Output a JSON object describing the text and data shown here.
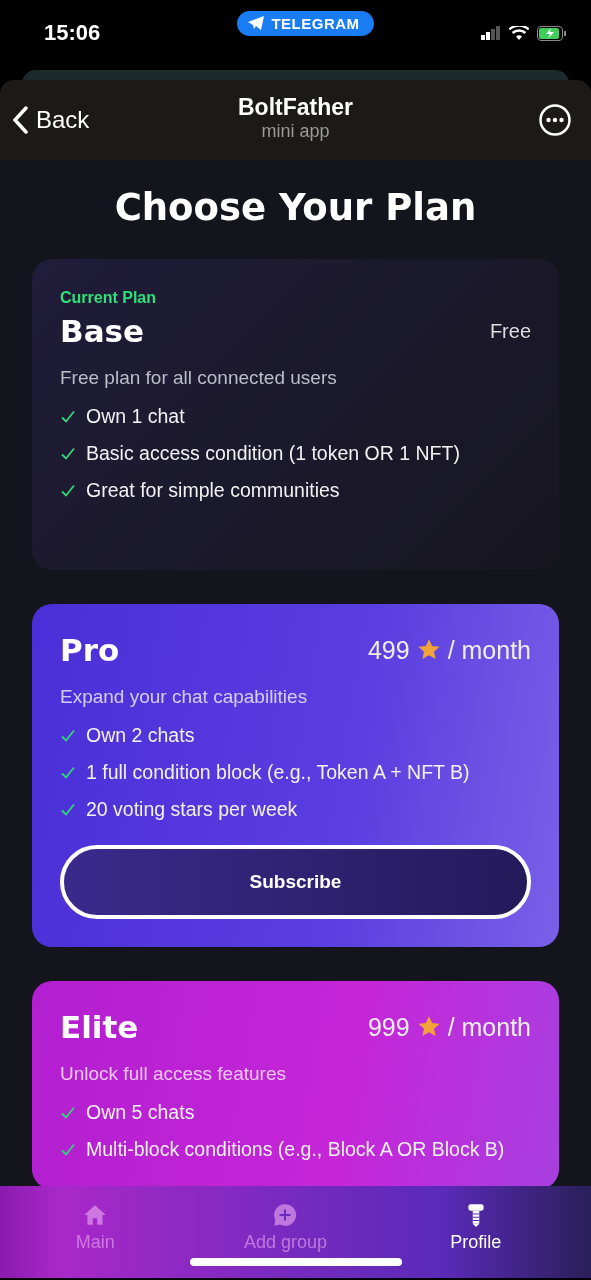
{
  "status_bar": {
    "time": "15:06",
    "app_pill": "TELEGRAM"
  },
  "header": {
    "back": "Back",
    "title": "BoltFather",
    "subtitle": "mini app"
  },
  "page_title": "Choose Your Plan",
  "plans": [
    {
      "kind": "current",
      "badge": "Current Plan",
      "name": "Base",
      "price": "Free",
      "description": "Free plan for all connected users",
      "features": [
        "Own 1 chat",
        "Basic access condition (1 token OR 1 NFT)",
        "Great for simple communities"
      ]
    },
    {
      "kind": "pro",
      "name": "Pro",
      "price": "499",
      "unit": "/ month",
      "description": "Expand your chat capabilities",
      "features": [
        "Own 2 chats",
        "1 full condition block (e.g., Token A + NFT B)",
        "20 voting stars per week"
      ],
      "button": "Subscribe"
    },
    {
      "kind": "elite",
      "name": "Elite",
      "price": "999",
      "unit": "/ month",
      "description": "Unlock full access features",
      "features": [
        "Own 5 chats",
        "Multi-block conditions (e.g., Block A OR Block B)"
      ]
    }
  ],
  "tab_bar": [
    {
      "kind": "home",
      "label": "Main",
      "selected": false
    },
    {
      "kind": "add",
      "label": "Add group",
      "selected": false
    },
    {
      "kind": "bolt",
      "label": "Profile",
      "selected": true
    }
  ]
}
